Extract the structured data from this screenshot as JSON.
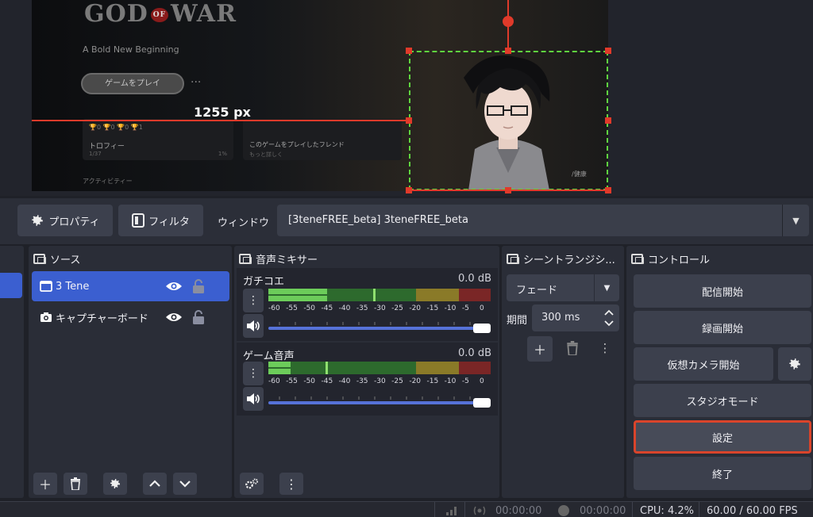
{
  "preview": {
    "game_logo_left": "GOD",
    "game_logo_of": "OF",
    "game_logo_right": "WAR",
    "tagline": "A Bold New Beginning",
    "play_button": "ゲームをプレイ",
    "more": "···",
    "trophy_counts": "🏆0  🏆0  🏆0  🏆1",
    "trophy_label": "トロフィー",
    "trophy_sub": "1/37",
    "trophy_pct": "1%",
    "friends_label": "このゲームをプレイしたフレンド",
    "friends_sub": "もっと詳しく",
    "activity": "アクティビティー",
    "health": "/健康",
    "measure_label": "1255 px"
  },
  "toolbar": {
    "properties_label": "プロパティ",
    "filters_label": "フィルタ",
    "window_label": "ウィンドウ",
    "window_value": "[3teneFREE_beta] 3teneFREE_beta"
  },
  "sources": {
    "title": "ソース",
    "items": [
      {
        "name": "3 Tene",
        "selected": true
      },
      {
        "name": "キャプチャーボード",
        "selected": false
      }
    ]
  },
  "mixer": {
    "title": "音声ミキサー",
    "channels": [
      {
        "name": "ガチコエ",
        "db": "0.0 dB",
        "level": 0.27
      },
      {
        "name": "ゲーム音声",
        "db": "0.0 dB",
        "level": 0.1
      }
    ],
    "scale": [
      "-60",
      "-55",
      "-50",
      "-45",
      "-40",
      "-35",
      "-30",
      "-25",
      "-20",
      "-15",
      "-10",
      "-5",
      "0"
    ]
  },
  "transitions": {
    "title": "シーントランジシ...",
    "type": "フェード",
    "duration_label": "期間",
    "duration_value": "300 ms"
  },
  "controls": {
    "title": "コントロール",
    "start_streaming": "配信開始",
    "start_recording": "録画開始",
    "start_virtual_cam": "仮想カメラ開始",
    "studio_mode": "スタジオモード",
    "settings": "設定",
    "exit": "終了"
  },
  "status": {
    "stream_time": "00:00:00",
    "record_time": "00:00:00",
    "cpu": "CPU: 4.2%",
    "fps": "60.00 / 60.00 FPS"
  },
  "colors": {
    "accent": "#3b5fd0",
    "highlight_border": "#d9442b",
    "selection_red": "#e03a2a",
    "selection_green": "#5fd43f"
  }
}
